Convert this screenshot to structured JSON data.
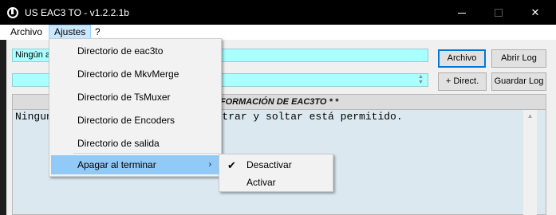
{
  "window": {
    "title": "US EAC3 TO - v1.2.2.1b",
    "minimize_glyph": "",
    "close_glyph": "✕"
  },
  "menubar": {
    "items": [
      "Archivo",
      "Ajustes",
      "?"
    ]
  },
  "inputs": {
    "file_value": "Ningún ar",
    "dir_value": ""
  },
  "buttons": {
    "archivo": "Archivo",
    "abrir_log": "Abrir Log",
    "add_dir": "+ Direct.",
    "guardar_log": "Guardar Log"
  },
  "info": {
    "header": "FORMACIÓN DE EAC3TO * *",
    "body_line1": "Ningun",
    "body_line2": "astrar y soltar está permitido."
  },
  "ajustes_menu": {
    "items": [
      "Directorio de eac3to",
      "Directorio de MkvMerge",
      "Directorio de TsMuxer",
      "Directorio de Encoders",
      "Directorio de salida",
      "Apagar al terminar"
    ],
    "submenu_arrow": "›"
  },
  "shutdown_submenu": {
    "items": [
      "Desactivar",
      "Activar"
    ],
    "checked": "Desactivar",
    "check_glyph": "✔"
  },
  "colors": {
    "titlebar": "#000000",
    "input_bg": "#aaffff",
    "menu_highlight": "#91c9f7",
    "textarea_bg": "#dce8f0"
  }
}
